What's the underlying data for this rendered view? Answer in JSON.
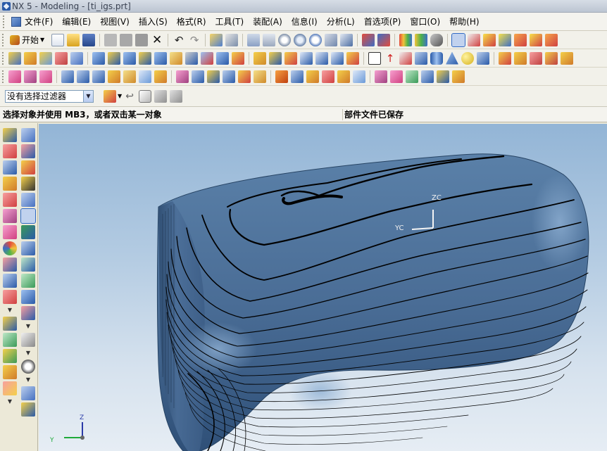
{
  "window": {
    "title": "NX 5 - Modeling - [ti_igs.prt]"
  },
  "menu": {
    "items": [
      "文件(F)",
      "编辑(E)",
      "视图(V)",
      "插入(S)",
      "格式(R)",
      "工具(T)",
      "装配(A)",
      "信息(I)",
      "分析(L)",
      "首选项(P)",
      "窗口(O)",
      "帮助(H)"
    ]
  },
  "toolbar": {
    "start_label": "开始"
  },
  "filter": {
    "value": "没有选择过滤器"
  },
  "status": {
    "prompt": "选择对象并使用 MB3，或者双击某一对象",
    "message": "部件文件已保存"
  },
  "viewport": {
    "wcs_z_label": "ZC",
    "wcs_y_label": "YC",
    "triad_z_label": "Z",
    "triad_y_label": "Y"
  },
  "colors": {
    "surface": "#4a6d96",
    "surface_dark": "#2c4a6e",
    "background_top": "#93b5d6",
    "background_bottom": "#e6edf4",
    "contour": "#000000"
  }
}
